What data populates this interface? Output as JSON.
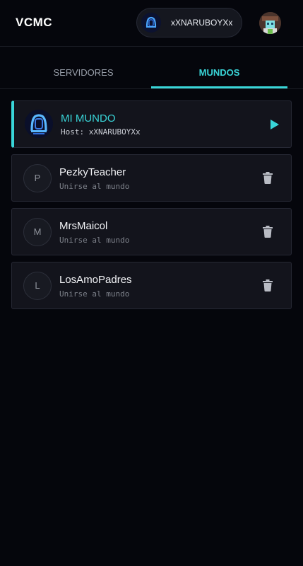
{
  "app": {
    "title": "VCMC"
  },
  "user": {
    "name": "xXNARUBOYXx"
  },
  "tabs": [
    {
      "label": "SERVIDORES",
      "active": false
    },
    {
      "label": "MUNDOS",
      "active": true
    }
  ],
  "host_world": {
    "title": "MI MUNDO",
    "subtitle": "Host: xXNARUBOYXx",
    "action_icon": "play-icon"
  },
  "worlds": [
    {
      "initial": "P",
      "name": "PezkyTeacher",
      "subtitle": "Unirse al mundo",
      "action_icon": "trash-icon"
    },
    {
      "initial": "M",
      "name": "MrsMaicol",
      "subtitle": "Unirse al mundo",
      "action_icon": "trash-icon"
    },
    {
      "initial": "L",
      "name": "LosAmoPadres",
      "subtitle": "Unirse al mundo",
      "action_icon": "trash-icon"
    }
  ],
  "colors": {
    "accent": "#39d5d8",
    "background": "#05060c",
    "card": "#13141c"
  }
}
